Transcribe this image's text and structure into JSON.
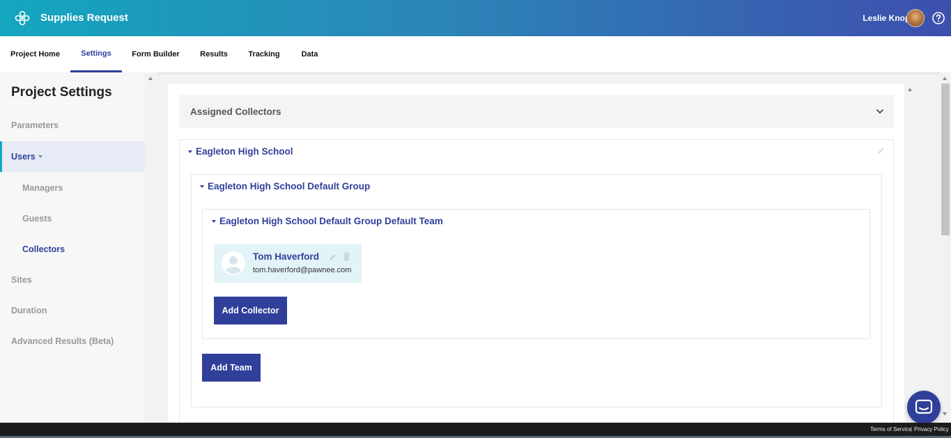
{
  "header": {
    "app_title": "Supplies Request",
    "user_name": "Leslie Knope",
    "logo_icon": "clover-logo-icon",
    "help_icon": "question-circle-icon"
  },
  "nav": {
    "tabs": [
      {
        "label": "Project Home",
        "active": false
      },
      {
        "label": "Settings",
        "active": true
      },
      {
        "label": "Form Builder",
        "active": false
      },
      {
        "label": "Results",
        "active": false
      },
      {
        "label": "Tracking",
        "active": false
      },
      {
        "label": "Data",
        "active": false
      }
    ]
  },
  "sidebar": {
    "title": "Project Settings",
    "items": [
      {
        "label": "Parameters"
      },
      {
        "label": "Users"
      },
      {
        "label": "Managers"
      },
      {
        "label": "Guests"
      },
      {
        "label": "Collectors"
      },
      {
        "label": "Sites"
      },
      {
        "label": "Duration"
      },
      {
        "label": "Advanced Results (Beta)"
      }
    ]
  },
  "main": {
    "section_title": "Assigned Collectors",
    "site_name": "Eagleton High School",
    "group_name": "Eagleton High School Default Group",
    "team_name": "Eagleton High School Default Group Default Team",
    "collector": {
      "name": "Tom Haverford",
      "email": "tom.haverford@pawnee.com"
    },
    "add_collector_label": "Add Collector",
    "add_team_label": "Add Team"
  },
  "footer": {
    "terms": "Terms of Service",
    "privacy": "Privacy Policy"
  },
  "colors": {
    "brand_primary": "#2f3f9a",
    "brand_accent": "#16a7c0",
    "collector_card_bg": "#e2f4f7"
  }
}
